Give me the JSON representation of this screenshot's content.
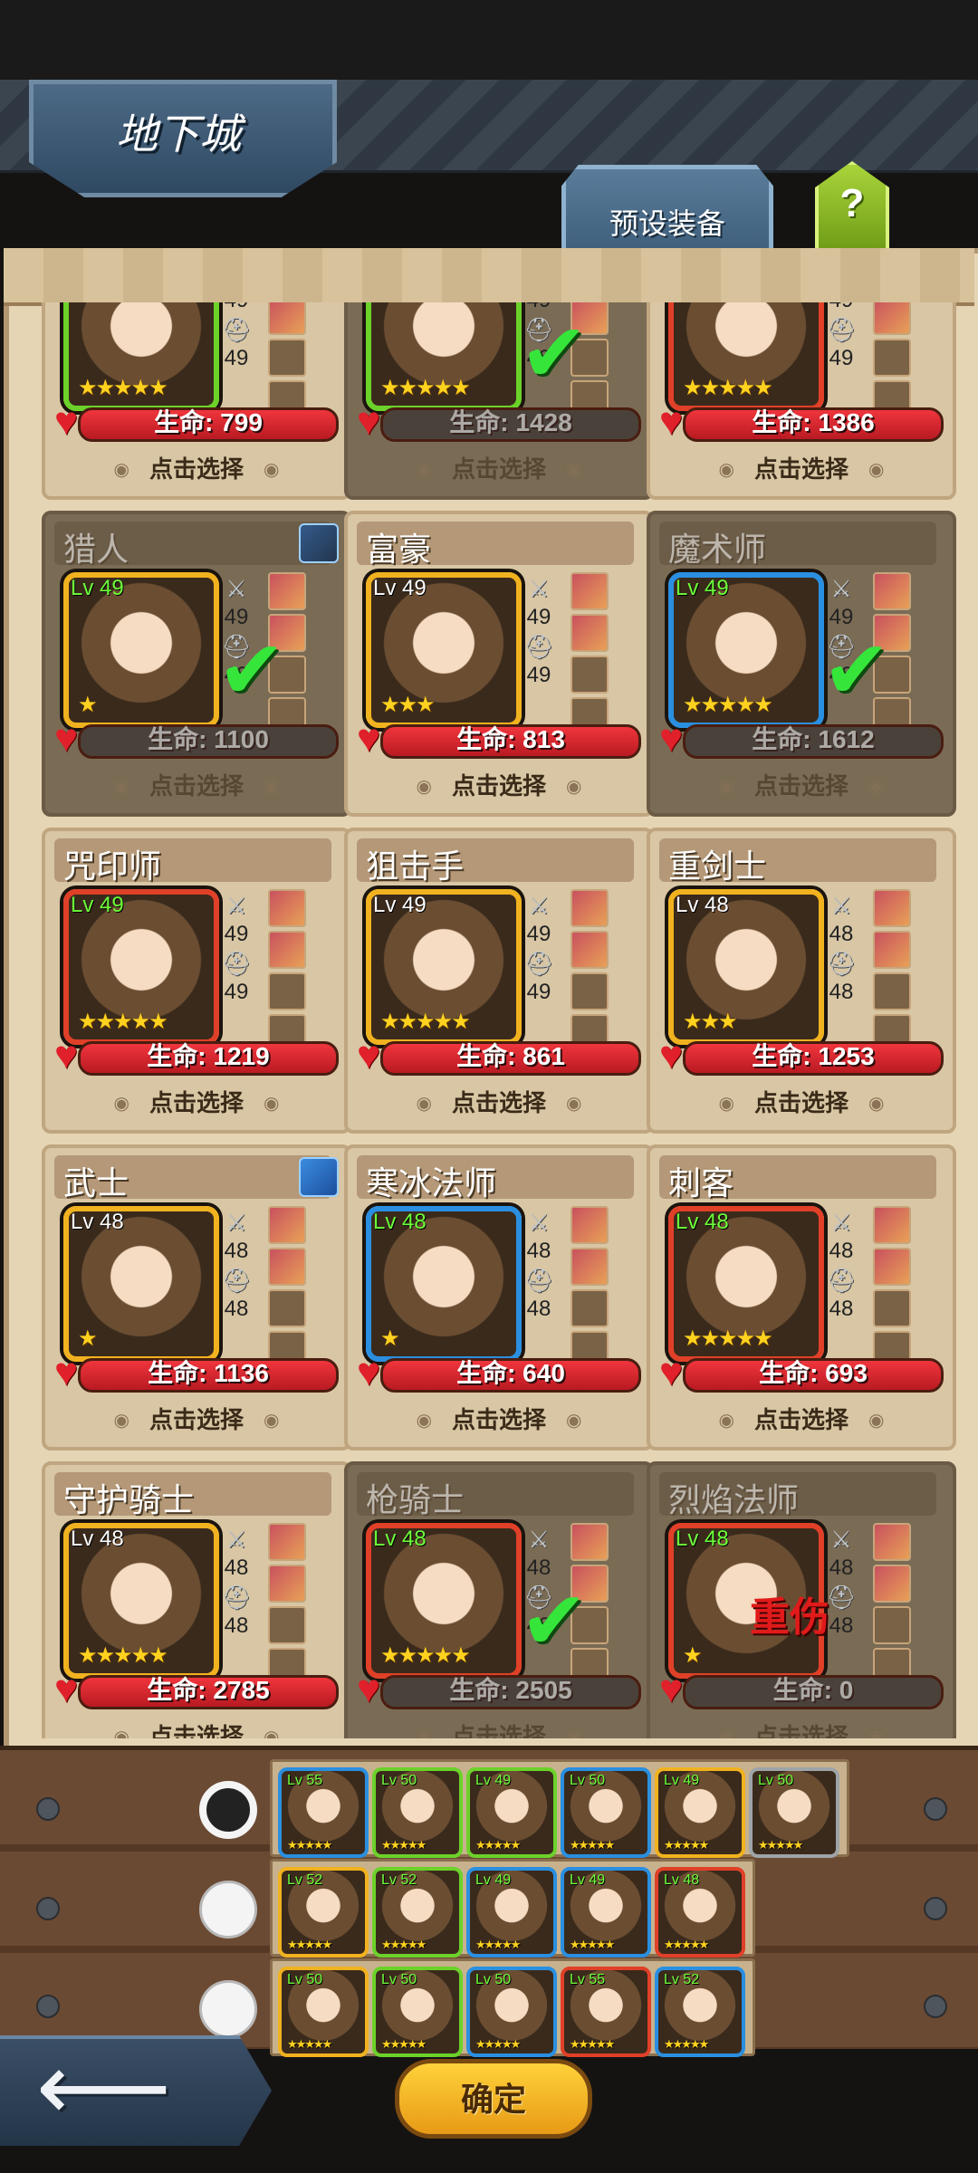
{
  "header": {
    "title": "地下城",
    "preset_tab": "预设装备",
    "help": "?"
  },
  "colors": {
    "hp_red": "#e0202a",
    "selected_check": "#36e53a",
    "confirm_gold": "#ffd23a"
  },
  "select_label": "点击选择",
  "wound_label": "重伤",
  "heroes": [
    {
      "name": "",
      "level": "",
      "hp": "生命: 799",
      "stars": "★★★★★",
      "eq": [
        "49",
        "49"
      ],
      "selected": false,
      "dim": false,
      "frame": "green"
    },
    {
      "name": "",
      "level": "",
      "hp": "生命: 1428",
      "stars": "★★★★★",
      "eq": [
        "49",
        "49"
      ],
      "selected": true,
      "dim": true,
      "frame": "green"
    },
    {
      "name": "",
      "level": "",
      "hp": "生命: 1386",
      "stars": "★★★★★",
      "eq": [
        "49",
        "49"
      ],
      "selected": false,
      "dim": false,
      "frame": "red"
    },
    {
      "name": "猎人",
      "level": "Lv 49",
      "hp": "生命: 1100",
      "stars": "★",
      "eq": [
        "49",
        "49"
      ],
      "selected": true,
      "dim": true,
      "frame": "gold"
    },
    {
      "name": "富豪",
      "level": "Lv 49",
      "hp": "生命: 813",
      "stars": "★★★",
      "eq": [
        "49",
        "49"
      ],
      "selected": false,
      "dim": false,
      "frame": "gold"
    },
    {
      "name": "魔术师",
      "level": "Lv 49",
      "hp": "生命: 1612",
      "stars": "★★★★★",
      "eq": [
        "49",
        "49"
      ],
      "selected": true,
      "dim": true,
      "frame": "blue"
    },
    {
      "name": "咒印师",
      "level": "Lv 49",
      "hp": "生命: 1219",
      "stars": "★★★★★",
      "eq": [
        "49",
        "49"
      ],
      "selected": false,
      "dim": false,
      "frame": "red"
    },
    {
      "name": "狙击手",
      "level": "Lv 49",
      "hp": "生命: 861",
      "stars": "★★★★★",
      "eq": [
        "49",
        "49"
      ],
      "selected": false,
      "dim": false,
      "frame": "gold"
    },
    {
      "name": "重剑士",
      "level": "Lv 48",
      "hp": "生命: 1253",
      "stars": "★★★",
      "eq": [
        "48",
        "48"
      ],
      "selected": false,
      "dim": false,
      "frame": "gold"
    },
    {
      "name": "武士",
      "level": "Lv 48",
      "hp": "生命: 1136",
      "stars": "★",
      "eq": [
        "48",
        "48"
      ],
      "selected": false,
      "dim": false,
      "frame": "gold"
    },
    {
      "name": "寒冰法师",
      "level": "Lv 48",
      "hp": "生命: 640",
      "stars": "★",
      "eq": [
        "48",
        "48"
      ],
      "selected": false,
      "dim": false,
      "frame": "blue"
    },
    {
      "name": "刺客",
      "level": "Lv 48",
      "hp": "生命: 693",
      "stars": "★★★★★",
      "eq": [
        "48",
        "48"
      ],
      "selected": false,
      "dim": false,
      "frame": "red"
    },
    {
      "name": "守护骑士",
      "level": "Lv 48",
      "hp": "生命: 2785",
      "stars": "★★★★★",
      "eq": [
        "48",
        "48"
      ],
      "selected": false,
      "dim": false,
      "frame": "gold"
    },
    {
      "name": "枪骑士",
      "level": "Lv 48",
      "hp": "生命: 2505",
      "stars": "★★★★★",
      "eq": [
        "48",
        "48"
      ],
      "selected": true,
      "dim": true,
      "frame": "red"
    },
    {
      "name": "烈焰法师",
      "level": "Lv 48",
      "hp": "生命: 0",
      "stars": "★",
      "eq": [
        "48",
        "48"
      ],
      "selected": false,
      "dim": true,
      "wounded": true,
      "frame": "red"
    }
  ],
  "teams": [
    {
      "selected": true,
      "members": [
        {
          "lv": "Lv 55",
          "f": "b"
        },
        {
          "lv": "Lv 50",
          "f": "g"
        },
        {
          "lv": "Lv 49",
          "f": "g"
        },
        {
          "lv": "Lv 50",
          "f": "b"
        },
        {
          "lv": "Lv 49",
          "f": "y"
        },
        {
          "lv": "Lv 50",
          "f": "gr"
        }
      ]
    },
    {
      "selected": false,
      "members": [
        {
          "lv": "Lv 52",
          "f": "y"
        },
        {
          "lv": "Lv 52",
          "f": "g"
        },
        {
          "lv": "Lv 49",
          "f": "b"
        },
        {
          "lv": "Lv 49",
          "f": "b"
        },
        {
          "lv": "Lv 48",
          "f": "r"
        }
      ]
    },
    {
      "selected": false,
      "members": [
        {
          "lv": "Lv 50",
          "f": "y"
        },
        {
          "lv": "Lv 50",
          "f": "g"
        },
        {
          "lv": "Lv 50",
          "f": "b"
        },
        {
          "lv": "Lv 55",
          "f": "r"
        },
        {
          "lv": "Lv 52",
          "f": "b"
        }
      ]
    }
  ],
  "footer": {
    "back_icon": "back-arrow-icon",
    "confirm": "确定"
  }
}
